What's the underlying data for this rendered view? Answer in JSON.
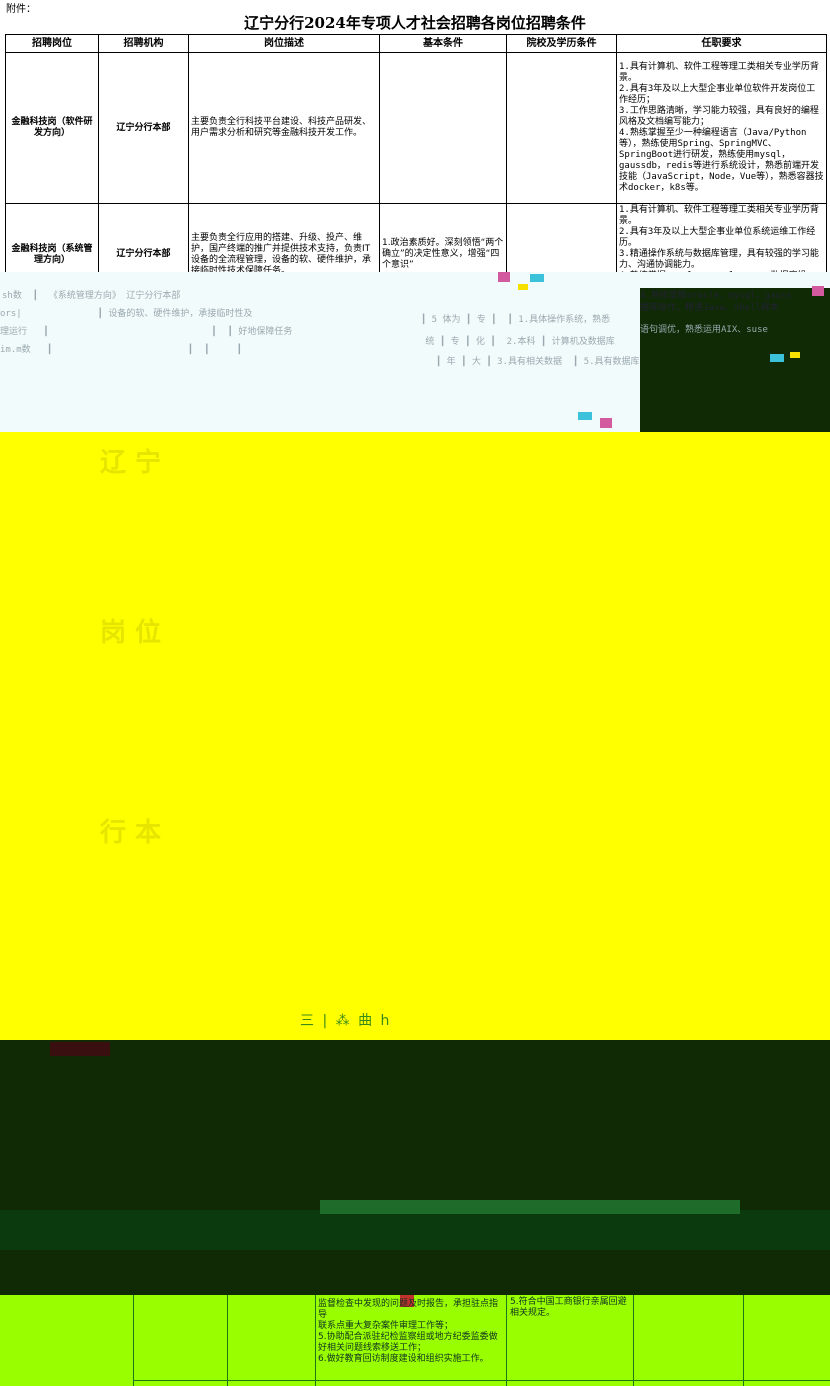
{
  "header": {
    "attachment_label": "附件：",
    "title": "辽宁分行2024年专项人才社会招聘各岗位招聘条件"
  },
  "table": {
    "columns": [
      "招聘岗位",
      "招聘机构",
      "岗位描述",
      "基本条件",
      "院校及学历条件",
      "任职要求"
    ],
    "rows": [
      {
        "position": "金融科技岗（软件研发方向）",
        "org": "辽宁分行本部",
        "description": "主要负责全行科技平台建设、科技产品研发、用户需求分析和研究等金融科技开发工作。",
        "requirements": "1.具有计算机、软件工程等理工类相关专业学历背景。\n2.具有3年及以上大型企事业单位软件开发岗位工作经历；\n3.工作思路清晰，学习能力较强，具有良好的编程风格及文档编写能力；\n4.熟练掌握至少一种编程语言（Java/Python等），熟练使用Spring、SpringMVC、SpringBoot进行研发，熟练使用mysql，gaussdb，redis等进行系统设计，熟悉前端开发技能（JavaScript，Node，Vue等），熟悉容器技术docker，k8s等。"
      },
      {
        "position": "金融科技岗（系统管理方向）",
        "org": "辽宁分行本部",
        "description": "主要负责全行应用的搭建、升级、投产、维护，国产终端的推广并提供技术支持，负责IT设备的全流程管理，设备的软、硬件维护，承接临时性技术保障任务。",
        "basic": "1.政治素质好。深刻领悟“两个确立”的决定性意义，增强“四个意识”",
        "requirements": "1.具有计算机、软件工程等理工类相关专业学历背景。\n2.具有3年及以上大型企事业单位系统运维工作经历。\n3.精通操作系统与数据库管理，具有较强的学习能力、沟通协调能力。\n4.熟练掌握oracle，mysql，gauss数据库操作，精通Java、Shell脚本语句调优，熟悉运用AIX、suse"
      }
    ]
  },
  "bottom_fragment": {
    "duties": "联系点重大复杂案件审理工作等；\n5.协助配合派驻纪检监察组或地方纪委监委做好相关问题线索移送工作；\n6.做好教育回访制度建设和组织实施工作。",
    "duties_prefix": "监督检查中发现的问题及时报告，承担驻点指导",
    "basic": "5.符合中国工商银行亲属回避相关规定。"
  }
}
